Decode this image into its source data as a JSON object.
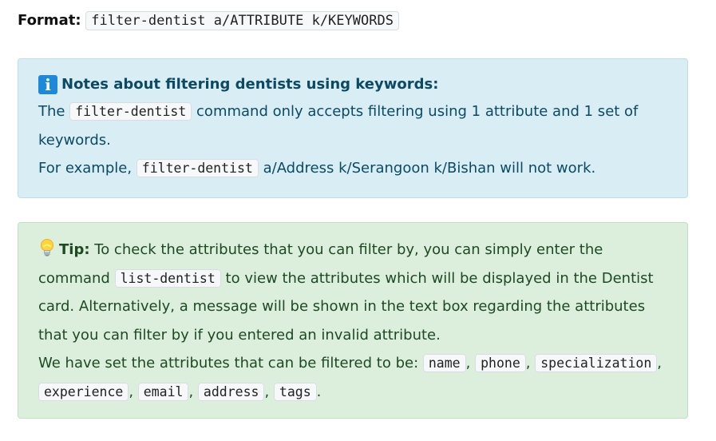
{
  "format": {
    "label": "Format:",
    "command": "filter-dentist a/ATTRIBUTE k/KEYWORDS"
  },
  "notes": {
    "icon": "info-icon",
    "title": "Notes about filtering dentists using keywords:",
    "p1_prefix": "The",
    "p1_code": "filter-dentist",
    "p1_suffix": "command only accepts filtering using 1 attribute and 1 set of keywords.",
    "p2_prefix": "For example,",
    "p2_code": "filter-dentist",
    "p2_suffix": "a/Address k/Serangoon k/Bishan will not work.",
    "colors": {
      "background": "#d9eef4",
      "text": "#0c4a63",
      "icon": "#1e88d9"
    }
  },
  "tip": {
    "icon": "lightbulb-icon",
    "label": "Tip:",
    "p1_part1": "To check the attributes that you can filter by, you can simply enter the command",
    "p1_code": "list-dentist",
    "p1_part2": "to view the attributes which will be displayed in the Dentist card. Alternatively, a message will be shown in the text box regarding the attributes that you can filter by if you entered an invalid attribute.",
    "p2_prefix": "We have set the attributes that can be filtered to be:",
    "attributes": [
      "name",
      "phone",
      "specialization",
      "experience",
      "email",
      "address",
      "tags"
    ],
    "p2_end": ".",
    "colors": {
      "background": "#dbefdc",
      "text": "#1d4a22"
    }
  }
}
